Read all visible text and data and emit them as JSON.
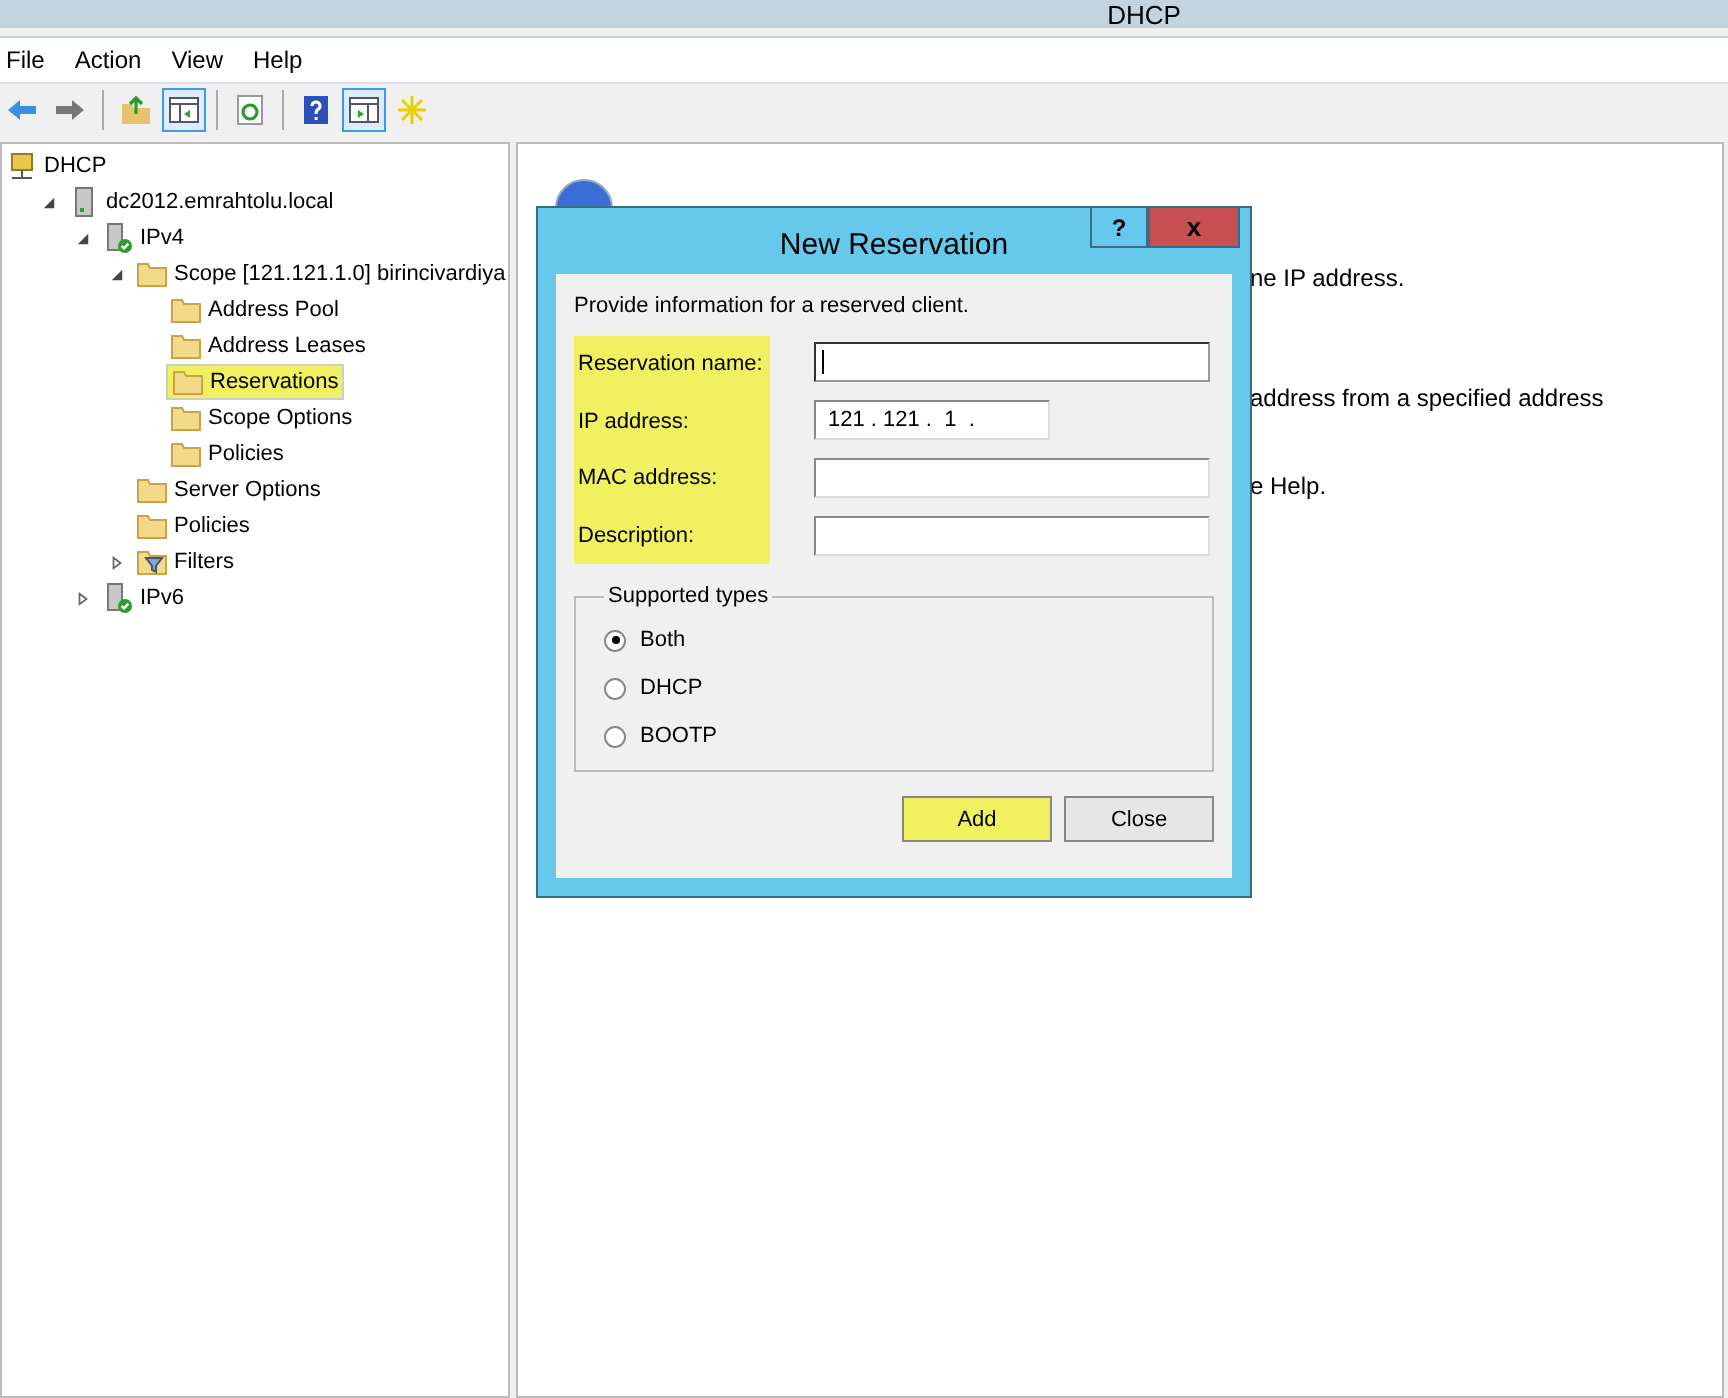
{
  "window": {
    "title": "DHCP"
  },
  "menu": [
    "File",
    "Action",
    "View",
    "Help"
  ],
  "toolbar": [
    {
      "kind": "back",
      "pressed": false
    },
    {
      "kind": "forward",
      "pressed": false
    },
    {
      "kind": "sep"
    },
    {
      "kind": "up",
      "pressed": false
    },
    {
      "kind": "tree",
      "pressed": true
    },
    {
      "kind": "sep"
    },
    {
      "kind": "refresh",
      "pressed": false
    },
    {
      "kind": "sep"
    },
    {
      "kind": "help",
      "pressed": false
    },
    {
      "kind": "pane",
      "pressed": true
    },
    {
      "kind": "star",
      "pressed": false
    }
  ],
  "tree": [
    {
      "label": "DHCP",
      "kind": "root",
      "highlighted": false,
      "children": [
        {
          "label": "dc2012.emrahtolu.local",
          "kind": "server",
          "expanded": true,
          "highlighted": false,
          "children": [
            {
              "label": "IPv4",
              "kind": "protocol",
              "expanded": true,
              "highlighted": false,
              "children": [
                {
                  "label": "Scope [121.121.1.0] birincivardiya",
                  "kind": "folder",
                  "expanded": true,
                  "highlighted": false,
                  "children": [
                    {
                      "label": "Address Pool",
                      "kind": "folder",
                      "highlighted": false
                    },
                    {
                      "label": "Address Leases",
                      "kind": "folder",
                      "highlighted": false
                    },
                    {
                      "label": "Reservations",
                      "kind": "folder",
                      "highlighted": true
                    },
                    {
                      "label": "Scope Options",
                      "kind": "folder",
                      "highlighted": false
                    },
                    {
                      "label": "Policies",
                      "kind": "folder",
                      "highlighted": false
                    }
                  ]
                },
                {
                  "label": "Server Options",
                  "kind": "folder",
                  "highlighted": false
                },
                {
                  "label": "Policies",
                  "kind": "folder",
                  "highlighted": false
                },
                {
                  "label": "Filters",
                  "kind": "filter",
                  "expanded": false,
                  "highlighted": false
                }
              ]
            },
            {
              "label": "IPv6",
              "kind": "protocol",
              "expanded": false,
              "highlighted": false
            }
          ]
        }
      ]
    }
  ],
  "content": {
    "lines": [
      "ne IP address.",
      "address from a specified address",
      "e Help."
    ]
  },
  "dialog": {
    "title": "New Reservation",
    "intro": "Provide information for a reserved client.",
    "labels_highlighted": true,
    "fields": [
      {
        "label": "Reservation name:",
        "kind": "text",
        "focused": true
      },
      {
        "label": "IP address:",
        "kind": "ip",
        "value": "121 . 121 .  1  ."
      },
      {
        "label": "MAC address:",
        "kind": "text",
        "focused": false
      },
      {
        "label": "Description:",
        "kind": "text",
        "focused": false
      }
    ],
    "group": {
      "title": "Supported types",
      "options": [
        {
          "label": "Both",
          "selected": true
        },
        {
          "label": "DHCP",
          "selected": false
        },
        {
          "label": "BOOTP",
          "selected": false
        }
      ]
    },
    "buttons": [
      {
        "label": "Add",
        "highlighted": true
      },
      {
        "label": "Close",
        "highlighted": false
      }
    ],
    "help": "?",
    "close": "x"
  }
}
